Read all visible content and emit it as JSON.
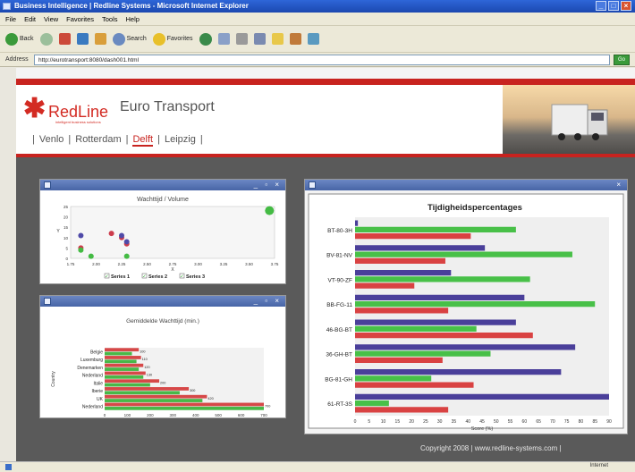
{
  "browser": {
    "title": "Business Intelligence | Redline Systems - Microsoft Internet Explorer",
    "menu": [
      "File",
      "Edit",
      "View",
      "Favorites",
      "Tools",
      "Help"
    ],
    "toolbar": {
      "back": "Back",
      "search": "Search",
      "favorites": "Favorites"
    },
    "address_label": "Address",
    "url": "http://eurotransport:8080/dash001.html",
    "go": "Go",
    "status_zone": "Internet"
  },
  "header": {
    "logo_star": "✱",
    "logo_red": "Red",
    "logo_line": "Line",
    "logo_tagline": "intelligent business solutions",
    "site_title": "Euro Transport"
  },
  "nav": {
    "items": [
      "Venlo",
      "Rotterdam",
      "Delft",
      "Leipzig"
    ],
    "active_index": 2
  },
  "panels": {
    "scatter": {
      "buttons": "_ ▫ ×"
    },
    "bar_small": {
      "buttons": "_ ▫ ×"
    },
    "bar_large": {
      "buttons": "×"
    }
  },
  "chart_data": [
    {
      "type": "scatter",
      "title": "Wachttijd / Volume",
      "xlabel": "X",
      "ylabel": "Y",
      "xlim": [
        1.75,
        3.75
      ],
      "ylim": [
        0,
        25
      ],
      "xticks": [
        "1.75",
        "2.00",
        "2.25",
        "2.50",
        "2.75",
        "3.00",
        "3.25",
        "3.50",
        "3.75"
      ],
      "yticks": [
        "0",
        "5",
        "10",
        "15",
        "20",
        "25"
      ],
      "series": [
        {
          "name": "Series 1",
          "color": "#cc3c4c",
          "points": [
            [
              1.85,
              5
            ],
            [
              2.15,
              12
            ],
            [
              2.25,
              10
            ],
            [
              2.3,
              7
            ]
          ]
        },
        {
          "name": "Series 2",
          "color": "#4f4aa8",
          "points": [
            [
              1.85,
              11
            ],
            [
              2.25,
              11
            ],
            [
              2.3,
              8
            ]
          ]
        },
        {
          "name": "Series 3",
          "color": "#44bb44",
          "points": [
            [
              1.85,
              4
            ],
            [
              1.95,
              1
            ],
            [
              2.3,
              1
            ],
            [
              3.7,
              23
            ]
          ]
        }
      ],
      "legend": [
        "Series 1",
        "Series 2",
        "Series 3"
      ]
    },
    {
      "type": "bar",
      "title": "Gemiddelde Wachttijd (min.)",
      "ylabel": "Country",
      "xlim": [
        0,
        700
      ],
      "xticks": [
        "0",
        "100",
        "200",
        "300",
        "400",
        "500",
        "600",
        "700"
      ],
      "categories": [
        "Belgie",
        "Luxemburg",
        "Denemarken",
        "Nederland",
        "Italie",
        "Iberie",
        "UK",
        "Nederland"
      ],
      "series": [
        {
          "name": "",
          "color": "#d64848",
          "values": [
            150,
            160,
            170,
            180,
            240,
            370,
            450,
            700
          ]
        },
        {
          "name": "",
          "color": "#48b848",
          "values": [
            120,
            140,
            150,
            170,
            200,
            330,
            430,
            700
          ]
        }
      ],
      "data_labels": [
        "100",
        "110",
        "120",
        "130",
        "200",
        "300",
        "420",
        "700"
      ]
    },
    {
      "type": "bar",
      "title": "Tijdigheidspercentages",
      "xlabel": "Score (%)",
      "xlim": [
        0,
        90
      ],
      "xticks": [
        "0",
        "5",
        "10",
        "15",
        "20",
        "25",
        "30",
        "35",
        "40",
        "45",
        "50",
        "55",
        "60",
        "65",
        "70",
        "75",
        "80",
        "85",
        "90"
      ],
      "categories": [
        "BT-80-3H",
        "BV-81-NV",
        "VT-90-ZF",
        "BB-FG-11",
        "46-BG-BT",
        "36-GH-BT",
        "BG-81-GH",
        "61-RT-3S"
      ],
      "series": [
        {
          "name": "",
          "color": "#4a3f9a",
          "values": [
            1,
            46,
            34,
            60,
            57,
            78,
            73,
            90
          ]
        },
        {
          "name": "",
          "color": "#48c048",
          "values": [
            57,
            77,
            62,
            85,
            43,
            48,
            27,
            12
          ]
        },
        {
          "name": "",
          "color": "#d94242",
          "values": [
            41,
            32,
            21,
            33,
            63,
            31,
            42,
            33
          ]
        }
      ]
    }
  ],
  "footer": {
    "copyright": "Copyright 2008 | www.redline-systems.com |"
  }
}
